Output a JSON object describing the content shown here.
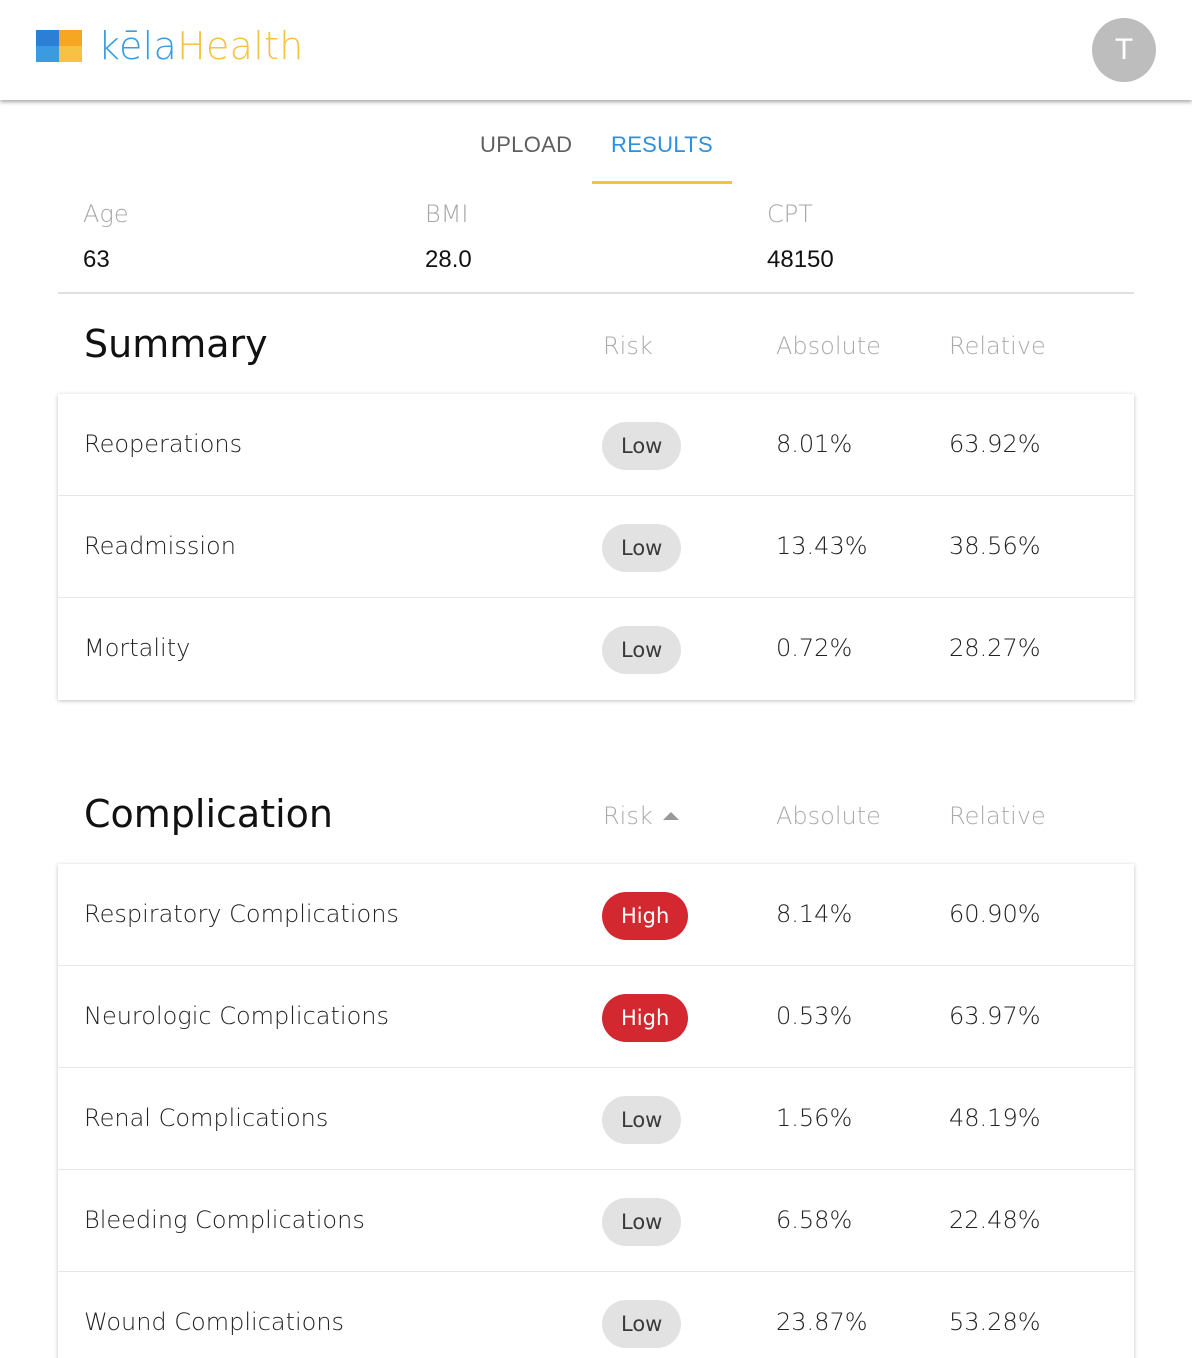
{
  "app": {
    "logo_text_a": "kēla",
    "logo_text_b": "Health",
    "avatar_initial": "T",
    "colors": {
      "brand_blue": "#3a9be0",
      "brand_orange": "#f5a623",
      "brand_yellow": "#f5c242",
      "high_red": "#d3282f"
    }
  },
  "tabs": [
    {
      "label": "UPLOAD",
      "active": false
    },
    {
      "label": "RESULTS",
      "active": true
    }
  ],
  "patient": {
    "age_label": "Age",
    "age_value": "63",
    "bmi_label": "BMI",
    "bmi_value": "28.0",
    "cpt_label": "CPT",
    "cpt_value": "48150"
  },
  "summary": {
    "title": "Summary",
    "col_risk": "Risk",
    "col_absolute": "Absolute",
    "col_relative": "Relative",
    "rows": [
      {
        "name": "Reoperations",
        "risk": "Low",
        "absolute": "8.01%",
        "relative": "63.92%"
      },
      {
        "name": "Readmission",
        "risk": "Low",
        "absolute": "13.43%",
        "relative": "38.56%"
      },
      {
        "name": "Mortality",
        "risk": "Low",
        "absolute": "0.72%",
        "relative": "28.27%"
      }
    ]
  },
  "complication": {
    "title": "Complication",
    "col_risk": "Risk",
    "col_absolute": "Absolute",
    "col_relative": "Relative",
    "sort_icon": "sort-ascending-icon",
    "rows": [
      {
        "name": "Respiratory Complications",
        "risk": "High",
        "absolute": "8.14%",
        "relative": "60.90%"
      },
      {
        "name": "Neurologic Complications",
        "risk": "High",
        "absolute": "0.53%",
        "relative": "63.97%"
      },
      {
        "name": "Renal Complications",
        "risk": "Low",
        "absolute": "1.56%",
        "relative": "48.19%"
      },
      {
        "name": "Bleeding Complications",
        "risk": "Low",
        "absolute": "6.58%",
        "relative": "22.48%"
      },
      {
        "name": "Wound Complications",
        "risk": "Low",
        "absolute": "23.87%",
        "relative": "53.28%"
      }
    ]
  }
}
